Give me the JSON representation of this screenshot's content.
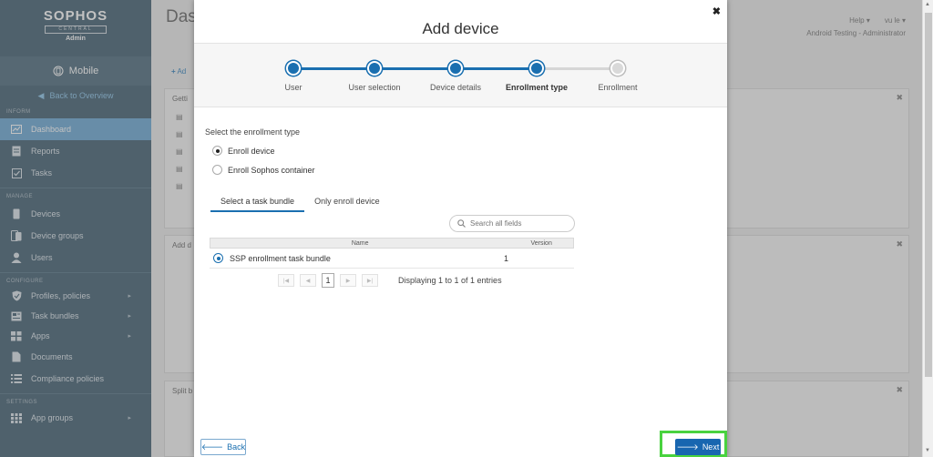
{
  "sidebar": {
    "brand": "SOPHOS",
    "brand_sub": "CENTRAL",
    "brand_role": "Admin",
    "product": "Mobile",
    "back_link": "Back to Overview",
    "sections": {
      "inform": "INFORM",
      "manage": "MANAGE",
      "configure": "CONFIGURE",
      "settings": "SETTINGS"
    },
    "inform_items": [
      {
        "label": "Dashboard",
        "icon": "chart-icon"
      },
      {
        "label": "Reports",
        "icon": "report-icon"
      },
      {
        "label": "Tasks",
        "icon": "tasks-icon"
      }
    ],
    "manage_items": [
      {
        "label": "Devices",
        "icon": "phone-icon"
      },
      {
        "label": "Device groups",
        "icon": "device-groups-icon"
      },
      {
        "label": "Users",
        "icon": "user-icon"
      }
    ],
    "configure_items": [
      {
        "label": "Profiles, policies",
        "icon": "shield-icon"
      },
      {
        "label": "Task bundles",
        "icon": "bundle-icon"
      },
      {
        "label": "Apps",
        "icon": "apps-icon"
      },
      {
        "label": "Documents",
        "icon": "document-icon"
      },
      {
        "label": "Compliance policies",
        "icon": "list-icon"
      }
    ],
    "settings_items": [
      {
        "label": "App groups",
        "icon": "app-groups-icon"
      }
    ]
  },
  "header": {
    "page_title": "Das",
    "help": "Help ▾",
    "user": "vu le ▾",
    "account": "Android Testing - Administrator"
  },
  "background_widgets": {
    "add_label": "Ad",
    "widget1_title": "Getti",
    "widget2_title": "Add d",
    "widget3_title": "Split b"
  },
  "modal": {
    "title": "Add device",
    "close": "✖",
    "steps": [
      {
        "label": "User",
        "state": "done"
      },
      {
        "label": "User selection",
        "state": "done"
      },
      {
        "label": "Device details",
        "state": "done"
      },
      {
        "label": "Enrollment type",
        "state": "current"
      },
      {
        "label": "Enrollment",
        "state": "pending"
      }
    ],
    "question": "Select the enrollment type",
    "options": [
      {
        "label": "Enroll device",
        "selected": true
      },
      {
        "label": "Enroll Sophos container",
        "selected": false
      }
    ],
    "tabs": [
      {
        "label": "Select a task bundle",
        "active": true
      },
      {
        "label": "Only enroll device",
        "active": false
      }
    ],
    "search_placeholder": "Search all fields",
    "table": {
      "columns": [
        "Name",
        "Version"
      ],
      "rows": [
        {
          "name": "SSP enrollment task bundle",
          "version": "1",
          "selected": true
        }
      ]
    },
    "pager": {
      "page": "1",
      "info": "Displaying 1 to 1 of 1 entries"
    },
    "back_button": "Back",
    "next_button": "Next"
  },
  "colors": {
    "sidebar_bg": "#2f4f63",
    "accent": "#1a6fb0",
    "highlight": "#49d23f"
  }
}
